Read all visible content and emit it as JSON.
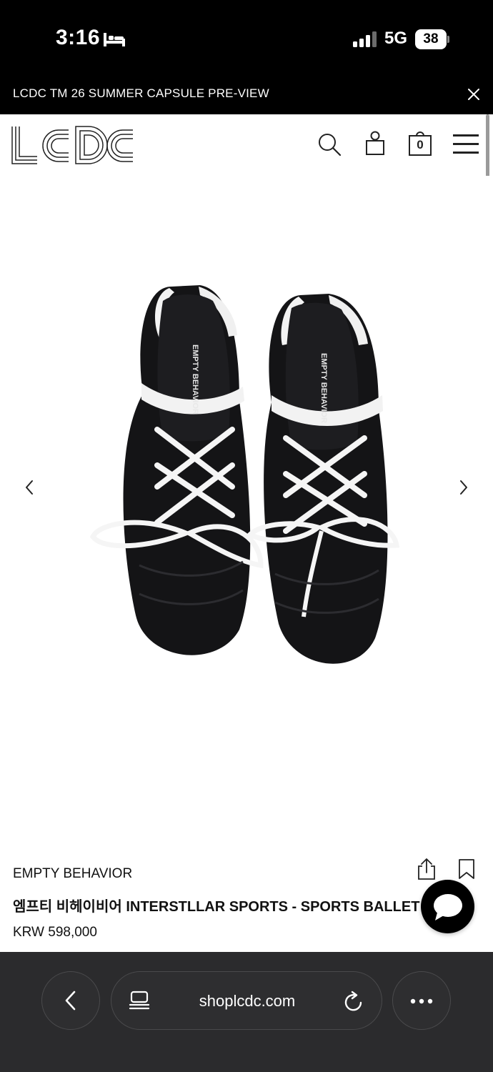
{
  "status_bar": {
    "time": "3:16",
    "network": "5G",
    "battery": "38",
    "icons": [
      "bed-icon",
      "signal-icon",
      "battery-icon"
    ]
  },
  "announcement": {
    "text": "LCDC TM 26 SUMMER CAPSULE PRE-VIEW",
    "close_icon": "close-icon"
  },
  "header": {
    "logo_text": "LCDC",
    "cart_count": "0",
    "icons": [
      "search-icon",
      "shopping-bag-icon",
      "cart-icon",
      "hamburger-menu-icon"
    ]
  },
  "carousel": {
    "image_text": "EMPTY BEHAVIOR",
    "prev_icon": "chevron-left-icon",
    "next_icon": "chevron-right-icon"
  },
  "product": {
    "brand": "EMPTY BEHAVIOR",
    "title": "엠프티 비헤이비어 INTERSTLLAR SPORTS - SPORTS BALLET (BL",
    "price": "KRW 598,000",
    "icons": [
      "share-icon",
      "bookmark-icon",
      "chat-icon"
    ]
  },
  "browser": {
    "url": "shoplcdc.com",
    "icons": [
      "back-arrow-icon",
      "reader-icon",
      "reload-icon",
      "more-icon"
    ]
  }
}
